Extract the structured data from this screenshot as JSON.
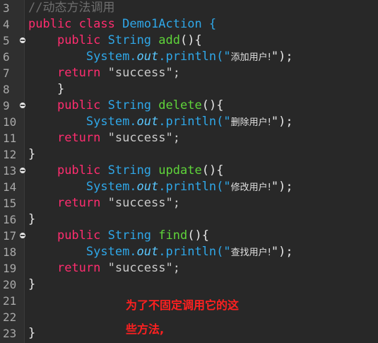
{
  "editor": {
    "lines": [
      {
        "n": "3",
        "fold": false,
        "indent": "",
        "parts": [
          {
            "t": "//动态方法调用",
            "c": "comment"
          }
        ]
      },
      {
        "n": "4",
        "fold": false,
        "indent": "",
        "parts": [
          {
            "t": "public",
            "c": "kw"
          },
          {
            "t": " ",
            "c": "punc"
          },
          {
            "t": "class",
            "c": "kw"
          },
          {
            "t": " Demo1Action {",
            "c": "type"
          }
        ]
      },
      {
        "n": "5",
        "fold": true,
        "indent": "    ",
        "parts": [
          {
            "t": "public",
            "c": "kw"
          },
          {
            "t": " ",
            "c": "punc"
          },
          {
            "t": "String",
            "c": "type"
          },
          {
            "t": " ",
            "c": "punc"
          },
          {
            "t": "add",
            "c": "fn"
          },
          {
            "t": "(){",
            "c": "punc"
          }
        ]
      },
      {
        "n": "6",
        "fold": false,
        "indent": "        ",
        "parts": [
          {
            "t": "System.",
            "c": "sys"
          },
          {
            "t": "out",
            "c": "it"
          },
          {
            "t": ".println(\"",
            "c": "sys"
          },
          {
            "t": "添加用户!",
            "c": "cn"
          },
          {
            "t": "\");",
            "c": "punc"
          }
        ]
      },
      {
        "n": "7",
        "fold": false,
        "indent": "    ",
        "parts": [
          {
            "t": "return",
            "c": "kw"
          },
          {
            "t": " \"success\";",
            "c": "str"
          }
        ]
      },
      {
        "n": "8",
        "fold": false,
        "indent": "    ",
        "parts": [
          {
            "t": "}",
            "c": "punc"
          }
        ]
      },
      {
        "n": "9",
        "fold": true,
        "indent": "    ",
        "parts": [
          {
            "t": "public",
            "c": "kw"
          },
          {
            "t": " ",
            "c": "punc"
          },
          {
            "t": "String",
            "c": "type"
          },
          {
            "t": " ",
            "c": "punc"
          },
          {
            "t": "delete",
            "c": "fn"
          },
          {
            "t": "(){",
            "c": "punc"
          }
        ]
      },
      {
        "n": "10",
        "fold": false,
        "indent": "        ",
        "parts": [
          {
            "t": "System.",
            "c": "sys"
          },
          {
            "t": "out",
            "c": "it"
          },
          {
            "t": ".println(\"",
            "c": "sys"
          },
          {
            "t": "删除用户!",
            "c": "cn"
          },
          {
            "t": "\");",
            "c": "punc"
          }
        ]
      },
      {
        "n": "11",
        "fold": false,
        "indent": "    ",
        "parts": [
          {
            "t": "return",
            "c": "kw"
          },
          {
            "t": " \"success\";",
            "c": "str"
          }
        ]
      },
      {
        "n": "12",
        "fold": false,
        "indent": "",
        "parts": [
          {
            "t": "}",
            "c": "punc"
          }
        ]
      },
      {
        "n": "13",
        "fold": true,
        "indent": "    ",
        "parts": [
          {
            "t": "public",
            "c": "kw"
          },
          {
            "t": " ",
            "c": "punc"
          },
          {
            "t": "String",
            "c": "type"
          },
          {
            "t": " ",
            "c": "punc"
          },
          {
            "t": "update",
            "c": "fn"
          },
          {
            "t": "(){",
            "c": "punc"
          }
        ]
      },
      {
        "n": "14",
        "fold": false,
        "indent": "        ",
        "parts": [
          {
            "t": "System.",
            "c": "sys"
          },
          {
            "t": "out",
            "c": "it"
          },
          {
            "t": ".println(\"",
            "c": "sys"
          },
          {
            "t": "修改用户!",
            "c": "cn"
          },
          {
            "t": "\");",
            "c": "punc"
          }
        ]
      },
      {
        "n": "15",
        "fold": false,
        "indent": "    ",
        "parts": [
          {
            "t": "return",
            "c": "kw"
          },
          {
            "t": " \"success\";",
            "c": "str"
          }
        ]
      },
      {
        "n": "16",
        "fold": false,
        "indent": "",
        "parts": [
          {
            "t": "}",
            "c": "punc"
          }
        ]
      },
      {
        "n": "17",
        "fold": true,
        "indent": "    ",
        "parts": [
          {
            "t": "public",
            "c": "kw"
          },
          {
            "t": " ",
            "c": "punc"
          },
          {
            "t": "String",
            "c": "type"
          },
          {
            "t": " ",
            "c": "punc"
          },
          {
            "t": "find",
            "c": "fn"
          },
          {
            "t": "(){",
            "c": "punc"
          }
        ]
      },
      {
        "n": "18",
        "fold": false,
        "indent": "        ",
        "parts": [
          {
            "t": "System.",
            "c": "sys"
          },
          {
            "t": "out",
            "c": "it"
          },
          {
            "t": ".println(\"",
            "c": "sys"
          },
          {
            "t": "查找用户!",
            "c": "cn"
          },
          {
            "t": "\");",
            "c": "punc"
          }
        ]
      },
      {
        "n": "19",
        "fold": false,
        "indent": "    ",
        "parts": [
          {
            "t": "return",
            "c": "kw"
          },
          {
            "t": " \"success\";",
            "c": "str"
          }
        ]
      },
      {
        "n": "20",
        "fold": false,
        "indent": "",
        "parts": [
          {
            "t": "}",
            "c": "punc"
          }
        ]
      },
      {
        "n": "21",
        "fold": false,
        "indent": "",
        "parts": []
      },
      {
        "n": "22",
        "fold": false,
        "indent": "",
        "parts": []
      },
      {
        "n": "23",
        "fold": false,
        "indent": "",
        "parts": [
          {
            "t": "}",
            "c": "punc"
          }
        ]
      }
    ]
  },
  "annotation": {
    "line1": "为了不固定调用它的这",
    "line2": "些方法,"
  },
  "colors": {
    "keyword": "#ff2d6f",
    "type": "#2fa7e8",
    "method": "#5fd53a",
    "string": "#c9c9c9",
    "annotation": "#ff2020",
    "background": "#282828"
  }
}
